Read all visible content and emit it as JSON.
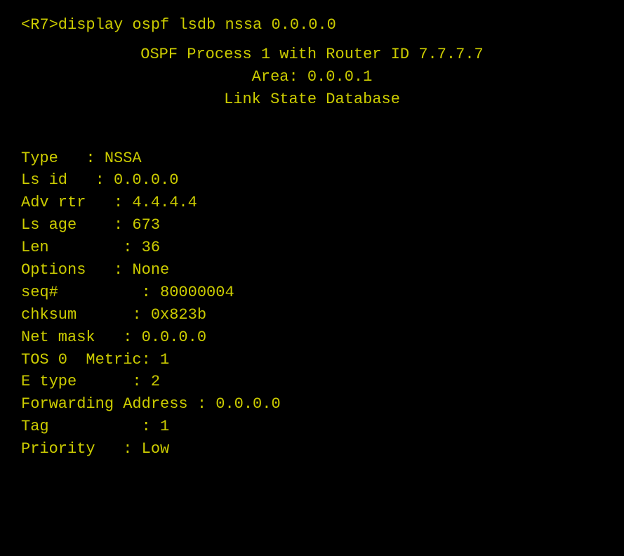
{
  "terminal": {
    "command": "<R7>display ospf lsdb nssa 0.0.0.0",
    "header": {
      "line1": "OSPF Process 1 with Router ID 7.7.7.7",
      "line2": "Area: 0.0.0.1",
      "line3": "Link State Database"
    },
    "fields": [
      {
        "label": "Type",
        "separator": "   : ",
        "value": "NSSA"
      },
      {
        "label": "Ls id",
        "separator": "   : ",
        "value": "0.0.0.0"
      },
      {
        "label": "Adv rtr",
        "separator": "   : ",
        "value": "4.4.4.4"
      },
      {
        "label": "Ls age",
        "separator": "    : ",
        "value": "673"
      },
      {
        "label": "Len",
        "separator": "        : ",
        "value": "36"
      },
      {
        "label": "Options",
        "separator": "   : ",
        "value": "None"
      },
      {
        "label": "seq#",
        "separator": "         : ",
        "value": "80000004"
      },
      {
        "label": "chksum",
        "separator": "      : ",
        "value": "0x823b"
      },
      {
        "label": "Net mask",
        "separator": "   : ",
        "value": "0.0.0.0"
      },
      {
        "label": "TOS 0  Metric: 1",
        "separator": "",
        "value": ""
      },
      {
        "label": "E type",
        "separator": "      : ",
        "value": "2"
      },
      {
        "label": "Forwarding Address : 0.0.0.0",
        "separator": "",
        "value": ""
      },
      {
        "label": "Tag",
        "separator": "          : ",
        "value": "1"
      },
      {
        "label": "Priority",
        "separator": "   : ",
        "value": "Low"
      }
    ]
  }
}
